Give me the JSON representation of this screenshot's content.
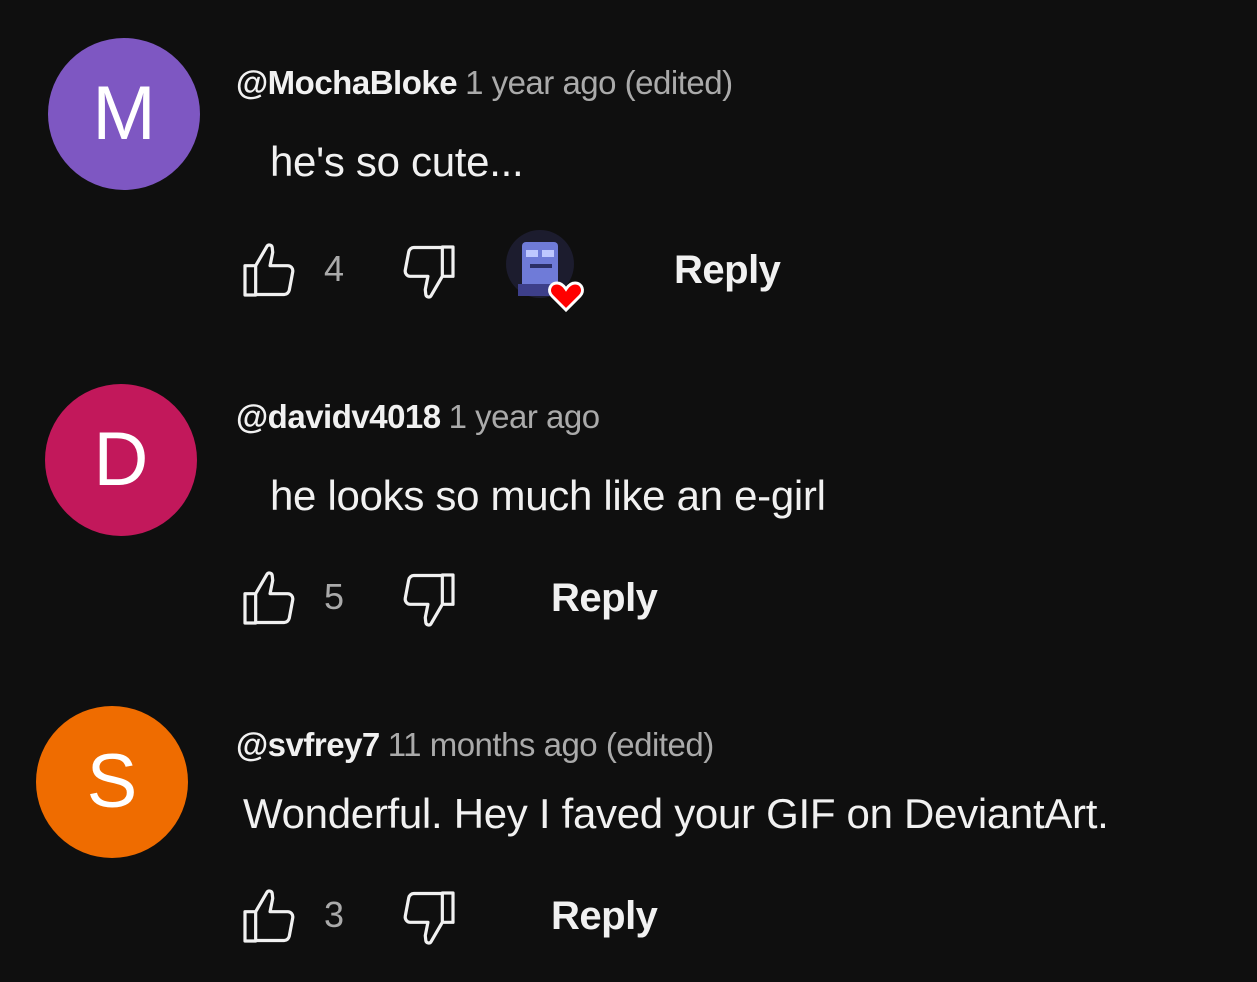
{
  "comments": [
    {
      "author": "@MochaBloke",
      "time": "1 year ago (edited)",
      "text": "he's so cute...",
      "likes": "4",
      "reply_label": "Reply",
      "avatar_letter": "M",
      "avatar_color": "#7e57c2",
      "creator_heart": true
    },
    {
      "author": "@davidv4018",
      "time": "1 year ago",
      "text": "he looks so much like an e-girl",
      "likes": "5",
      "reply_label": "Reply",
      "avatar_letter": "D",
      "avatar_color": "#c2185b",
      "creator_heart": false
    },
    {
      "author": "@svfrey7",
      "time": "11 months ago (edited)",
      "text": "Wonderful. Hey I faved your GIF on DeviantArt.",
      "likes": "3",
      "reply_label": "Reply",
      "avatar_letter": "S",
      "avatar_color": "#ef6c00",
      "creator_heart": false
    }
  ],
  "icons": {
    "like": "thumbs-up-icon",
    "dislike": "thumbs-down-icon",
    "heart": "heart-icon"
  },
  "colors": {
    "background": "#0f0f0f",
    "primary_text": "#f1f1f1",
    "secondary_text": "#aaaaaa",
    "heart": "#ff0000"
  }
}
